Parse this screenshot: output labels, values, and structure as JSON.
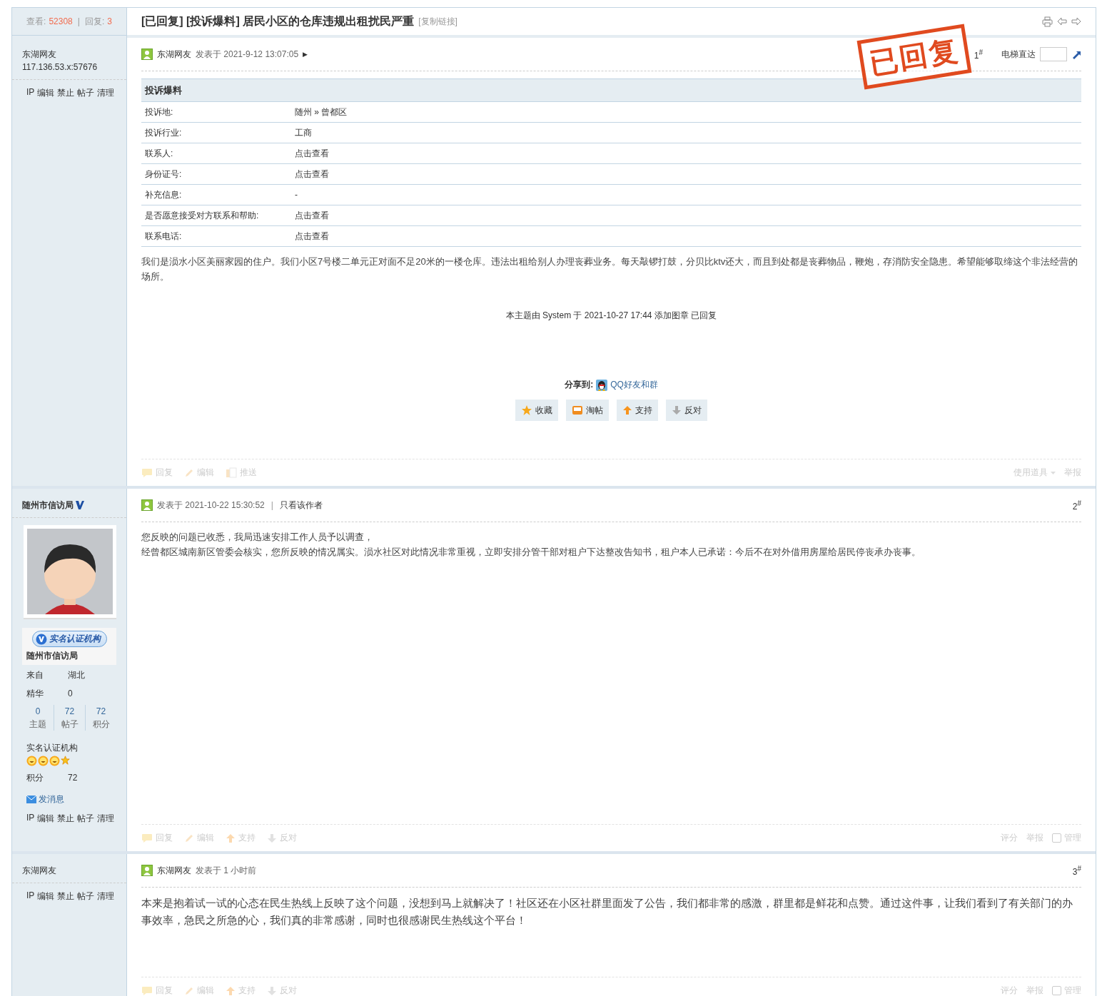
{
  "thread": {
    "views_label": "查看:",
    "views": "52308",
    "replies_label": "回复:",
    "replies": "3",
    "separator": "|",
    "title": "[已回复] [投诉爆料] 居民小区的仓库违规出租扰民严重",
    "copy_link": "[复制链接]"
  },
  "jump": {
    "label": "电梯直达"
  },
  "posts": [
    {
      "author": "东湖网友",
      "verified": false,
      "ip": "117.136.53.x:57676",
      "admin_links": [
        "IP",
        "编辑",
        "禁止",
        "帖子",
        "清理"
      ],
      "meta_author": "东湖网友",
      "posted": "发表于 2021-9-12 13:07:05",
      "expand": "▶",
      "floor": "1",
      "floor_mark": "#",
      "stamp": "已回复",
      "form": {
        "title": "投诉爆料",
        "rows": [
          {
            "label": "投诉地:",
            "value": "随州 » 曾都区"
          },
          {
            "label": "投诉行业:",
            "value": "工商"
          },
          {
            "label": "联系人:",
            "value": "点击查看"
          },
          {
            "label": "身份证号:",
            "value": "点击查看"
          },
          {
            "label": "补充信息:",
            "value": "-"
          },
          {
            "label": "是否愿意接受对方联系和帮助:",
            "value": "点击查看"
          },
          {
            "label": "联系电话:",
            "value": "点击查看"
          }
        ]
      },
      "body": [
        {
          "kind": "plain",
          "text": "我们是涢水小区美丽家园的住户。我们小区7号楼二单元正对面不足20米的一楼仓库。违法出租给别人办理丧葬业务。每天敲锣打鼓，分贝比ktv还大，而且到处都是丧葬物品，鞭炮，存消防安全隐患。希望能够取缔这个非法经营的场所。"
        }
      ],
      "notice": "本主题由 System 于 2021-10-27 17:44 添加图章 已回复",
      "share": {
        "label": "分享到:",
        "link": "QQ好友和群"
      },
      "buttons": [
        {
          "kind": "star",
          "label": "收藏"
        },
        {
          "kind": "tray",
          "label": "淘帖"
        },
        {
          "kind": "up",
          "label": "支持"
        },
        {
          "kind": "down",
          "label": "反对"
        }
      ],
      "actions": [
        {
          "kind": "bubble",
          "label": "回复"
        },
        {
          "kind": "pencil",
          "label": "编辑"
        },
        {
          "kind": "push",
          "label": "推送"
        }
      ],
      "right_actions": [
        {
          "kind": "menu",
          "label": "使用道具"
        },
        {
          "kind": "text",
          "label": "举报"
        }
      ]
    },
    {
      "author": "随州市信访局",
      "verified": true,
      "badge": "实名认证机构",
      "org": "随州市信访局",
      "admin_links": [
        "IP",
        "编辑",
        "禁止",
        "帖子",
        "清理"
      ],
      "info": [
        {
          "label": "来自",
          "value": "湖北"
        },
        {
          "label": "精华",
          "value": "0"
        }
      ],
      "stats": [
        {
          "value": "0",
          "label": "主题"
        },
        {
          "value": "72",
          "label": "帖子"
        },
        {
          "value": "72",
          "label": "积分"
        }
      ],
      "group": "实名认证机构",
      "rank": [
        {
          "kind": "sun"
        },
        {
          "kind": "sun"
        },
        {
          "kind": "sun"
        },
        {
          "kind": "star"
        }
      ],
      "points": {
        "label": "积分",
        "value": "72"
      },
      "message": "发消息",
      "posted": "发表于 2021-10-22 15:30:52",
      "separator": "|",
      "only_author": "只看该作者",
      "floor": "2",
      "floor_mark": "#",
      "body": [
        {
          "kind": "plain",
          "text": "您反映的问题已收悉，我局迅速安排工作人员予以调查，"
        },
        {
          "kind": "plain",
          "text": "经曾都区城南新区管委会核实，您所反映的情况属实。涢水社区对此情况非常重视，立即安排分管干部对租户下达整改告知书，租户本人已承诺：今后不在对外借用房屋给居民停丧承办丧事。"
        }
      ],
      "actions": [
        {
          "kind": "bubble",
          "label": "回复"
        },
        {
          "kind": "pencil",
          "label": "编辑"
        },
        {
          "kind": "up",
          "label": "支持"
        },
        {
          "kind": "down",
          "label": "反对"
        }
      ],
      "right_actions": [
        {
          "kind": "text",
          "label": "评分"
        },
        {
          "kind": "text",
          "label": "举报"
        },
        {
          "kind": "check",
          "label": "管理",
          "checked": false
        }
      ]
    },
    {
      "author": "东湖网友",
      "verified": false,
      "admin_links": [
        "IP",
        "编辑",
        "禁止",
        "帖子",
        "清理"
      ],
      "meta_author": "东湖网友",
      "posted": "发表于 1 小时前",
      "floor": "3",
      "floor_mark": "#",
      "body": [
        {
          "kind": "large",
          "text": "本来是抱着试一试的心态在民生热线上反映了这个问题，没想到马上就解决了！社区还在小区社群里面发了公告，我们都非常的感激，群里都是鲜花和点赞。通过这件事，让我们看到了有关部门的办事效率，急民之所急的心，我们真的非常感谢，同时也很感谢民生热线这个平台！"
        }
      ],
      "actions": [
        {
          "kind": "bubble",
          "label": "回复"
        },
        {
          "kind": "pencil",
          "label": "编辑"
        },
        {
          "kind": "up",
          "label": "支持"
        },
        {
          "kind": "down",
          "label": "反对"
        }
      ],
      "right_actions": [
        {
          "kind": "text",
          "label": "评分"
        },
        {
          "kind": "text",
          "label": "举报"
        },
        {
          "kind": "check",
          "label": "管理",
          "checked": false
        }
      ]
    }
  ]
}
